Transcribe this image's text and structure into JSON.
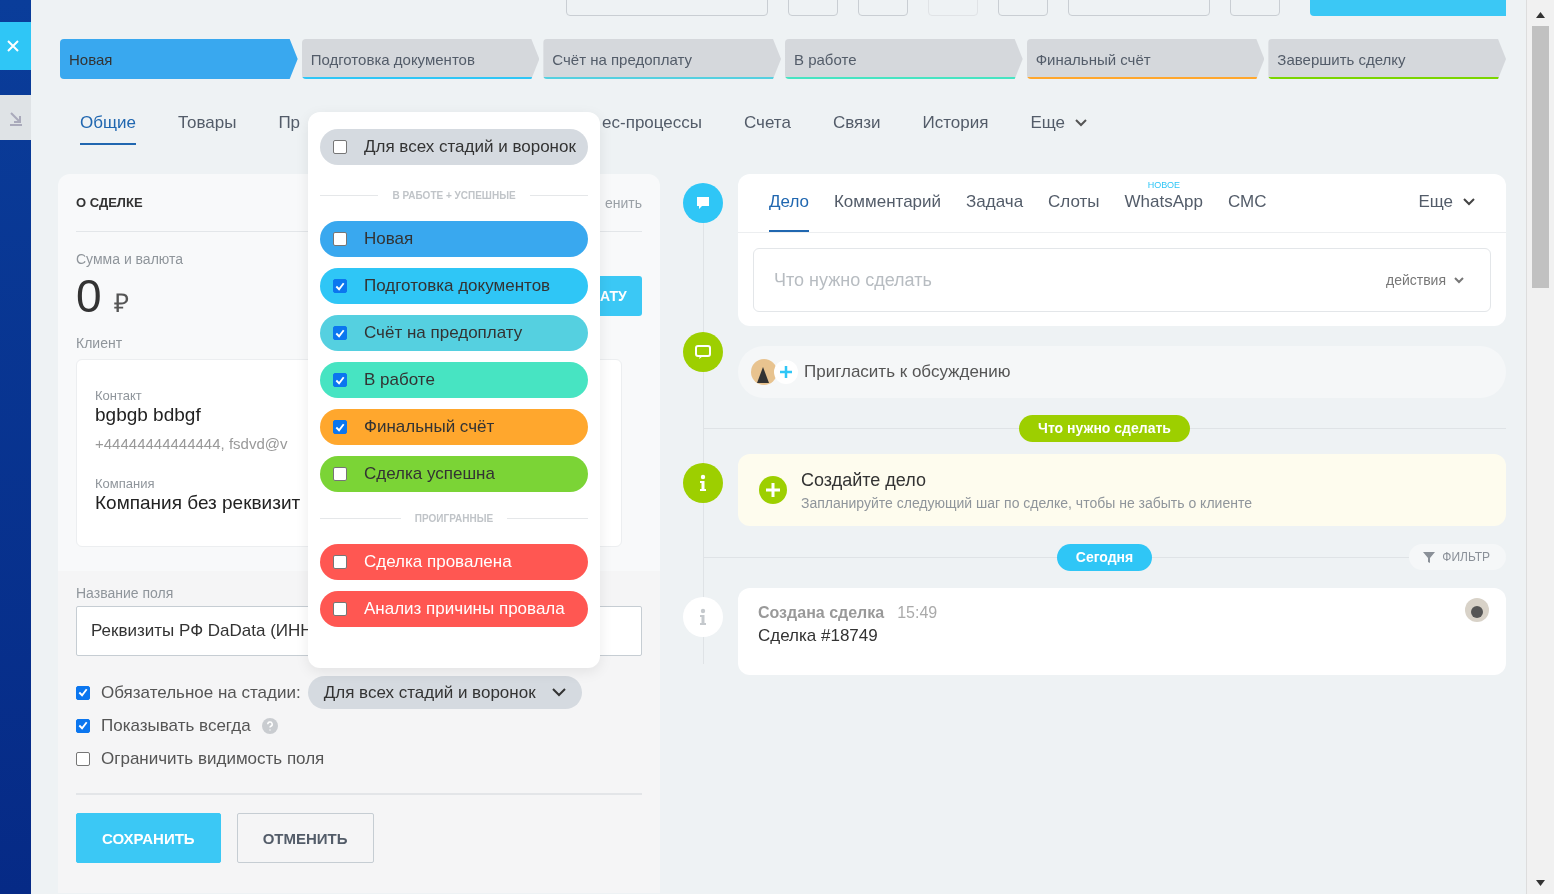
{
  "stages": [
    {
      "label": "Новая",
      "color": "#39a8ef",
      "selected": true
    },
    {
      "label": "Подготовка документов",
      "color": "#2fc6f6",
      "selected": false
    },
    {
      "label": "Счёт на предоплату",
      "color": "#55d0e0",
      "selected": false
    },
    {
      "label": "В работе",
      "color": "#47e4c2",
      "selected": false
    },
    {
      "label": "Финальный счёт",
      "color": "#ffa72d",
      "selected": false
    },
    {
      "label": "Завершить сделку",
      "color": "#7bd500",
      "selected": false
    }
  ],
  "tabs": [
    {
      "label": "Общие",
      "selected": true,
      "kind": "tab"
    },
    {
      "label": "Товары",
      "selected": false,
      "kind": "tab"
    },
    {
      "label": "Пр",
      "selected": false,
      "kind": "tab"
    },
    {
      "label": "ес-процессы",
      "selected": false,
      "kind": "tab"
    },
    {
      "label": "Счета",
      "selected": false,
      "kind": "tab"
    },
    {
      "label": "Связи",
      "selected": false,
      "kind": "tab"
    },
    {
      "label": "История",
      "selected": false,
      "kind": "tab"
    },
    {
      "label": "Еще",
      "selected": false,
      "kind": "menu"
    }
  ],
  "deal_card": {
    "title": "О СДЕЛКЕ",
    "edit_link": "енить",
    "amount_label": "Сумма и валюта",
    "amount": "0",
    "currency": "₽",
    "pay_button": "АТУ",
    "client_label": "Клиент",
    "contact_label": "Контакт",
    "contact_name": "bgbgb bdbgf",
    "contact_details": "+44444444444444, fsdvd@v",
    "company_label": "Компания",
    "company_name": "Компания без реквизит"
  },
  "field_editor": {
    "name_label": "Название поля",
    "name_value": "Реквизиты РФ DaData (ИНН",
    "options": [
      {
        "kind": "select",
        "label": "Обязательное на стадии:",
        "checked": true,
        "value": "Для всех стадий и воронок"
      },
      {
        "kind": "help",
        "label": "Показывать всегда",
        "checked": true
      },
      {
        "kind": "plain",
        "label": "Ограничить видимость поля",
        "checked": false
      }
    ],
    "buttons": [
      {
        "label": "СОХРАНИТЬ",
        "kind": "primary"
      },
      {
        "label": "ОТМЕНИТЬ",
        "kind": "secondary"
      }
    ]
  },
  "stage_dropdown": {
    "all_option": {
      "label": "Для всех стадий и воронок",
      "checked": false
    },
    "groups": [
      {
        "title": "В РАБОТЕ + УСПЕШНЫЕ",
        "kind": "success",
        "items": [
          {
            "label": "Новая",
            "checked": false,
            "color": "#39a8ef"
          },
          {
            "label": "Подготовка документов",
            "checked": true,
            "color": "#2fc6f6"
          },
          {
            "label": "Счёт на предоплату",
            "checked": true,
            "color": "#55d0e0"
          },
          {
            "label": "В работе",
            "checked": true,
            "color": "#47e4c2"
          },
          {
            "label": "Финальный счёт",
            "checked": true,
            "color": "#ffa72d"
          },
          {
            "label": "Сделка успешна",
            "checked": false,
            "color": "#7bd436"
          }
        ]
      },
      {
        "title": "ПРОИГРАННЫЕ",
        "kind": "failure",
        "items": [
          {
            "label": "Сделка провалена",
            "checked": false,
            "color": "#ff5752"
          },
          {
            "label": "Анализ причины провала",
            "checked": false,
            "color": "#ff5752"
          }
        ]
      }
    ]
  },
  "timeline": {
    "composer": {
      "tabs": [
        {
          "label": "Дело",
          "selected": true
        },
        {
          "label": "Комментарий",
          "selected": false
        },
        {
          "label": "Задача",
          "selected": false
        },
        {
          "label": "Слоты",
          "selected": false
        },
        {
          "label": "WhatsApp",
          "selected": false,
          "badge": "НОВОЕ"
        },
        {
          "label": "СМС",
          "selected": false
        }
      ],
      "more": "Еще",
      "placeholder": "Что нужно сделать",
      "actions": "действия"
    },
    "invite": "Пригласить к обсуждению",
    "planned_badge": "Что нужно сделать",
    "hint": {
      "title": "Создайте дело",
      "text": "Запланируйте следующий шаг по сделке, чтобы не забыть о клиенте"
    },
    "today_badge": "Сегодня",
    "filter": "ФИЛЬТР",
    "event": {
      "title": "Создана сделка",
      "time": "15:49",
      "text": "Сделка #18749"
    }
  }
}
